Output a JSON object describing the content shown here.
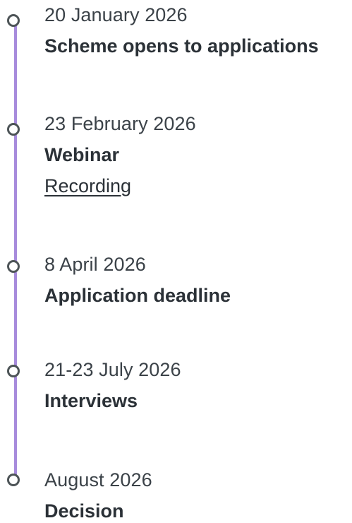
{
  "timeline": {
    "events": [
      {
        "date": "20 January 2026",
        "title": "Scheme opens to applications"
      },
      {
        "date": "23 February 2026",
        "title": "Webinar",
        "link": "Recording"
      },
      {
        "date": "8 April 2026",
        "title": "Application deadline"
      },
      {
        "date": "21-23 July 2026",
        "title": "Interviews"
      },
      {
        "date": "August 2026",
        "title": "Decision"
      }
    ]
  },
  "colors": {
    "rail": "#a78bdc",
    "node_border": "#4d5457",
    "text": "#2b3137"
  },
  "icons": {
    "node": "circle-node-icon"
  }
}
